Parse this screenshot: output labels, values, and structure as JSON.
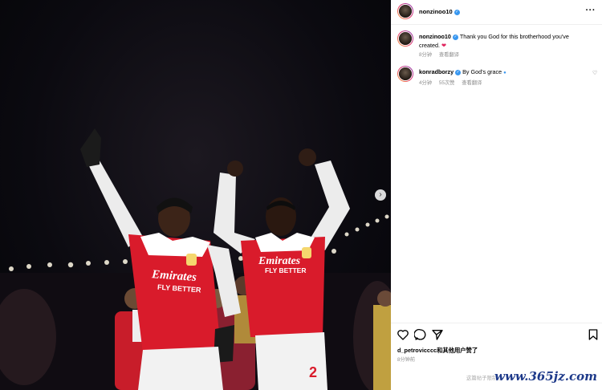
{
  "header": {
    "username": "nonzinoo10",
    "more_label": "···"
  },
  "caption": {
    "username": "nonzinoo10",
    "text": "Thank you God for this brotherhood you've created.",
    "emoji": "❤",
    "time": "8分钟",
    "translate": "查看翻译"
  },
  "comments": [
    {
      "username": "konradborzy",
      "text": "By God’s grace",
      "time": "4分钟",
      "likes": "55次赞",
      "translate": "查看翻译"
    }
  ],
  "liked_by": {
    "user": "d_petrovicccc",
    "suffix": "和其他用户赞了"
  },
  "post_time": "8分钟前",
  "watermark_text": "这篇帖子限制了",
  "site_text": "www.365jz.com",
  "photo": {
    "shirt_sponsor_line1": "Emirates",
    "shirt_sponsor_line2": "FLY BETTER",
    "shorts_number": "2"
  },
  "colors": {
    "verified": "#3897f0",
    "arsenal_red": "#d91b2b",
    "muted_text": "#8e8e8e"
  },
  "icons": [
    "chevron-right-icon",
    "more-icon",
    "verified-icon",
    "heart-icon",
    "comment-icon",
    "share-icon",
    "bookmark-icon"
  ]
}
